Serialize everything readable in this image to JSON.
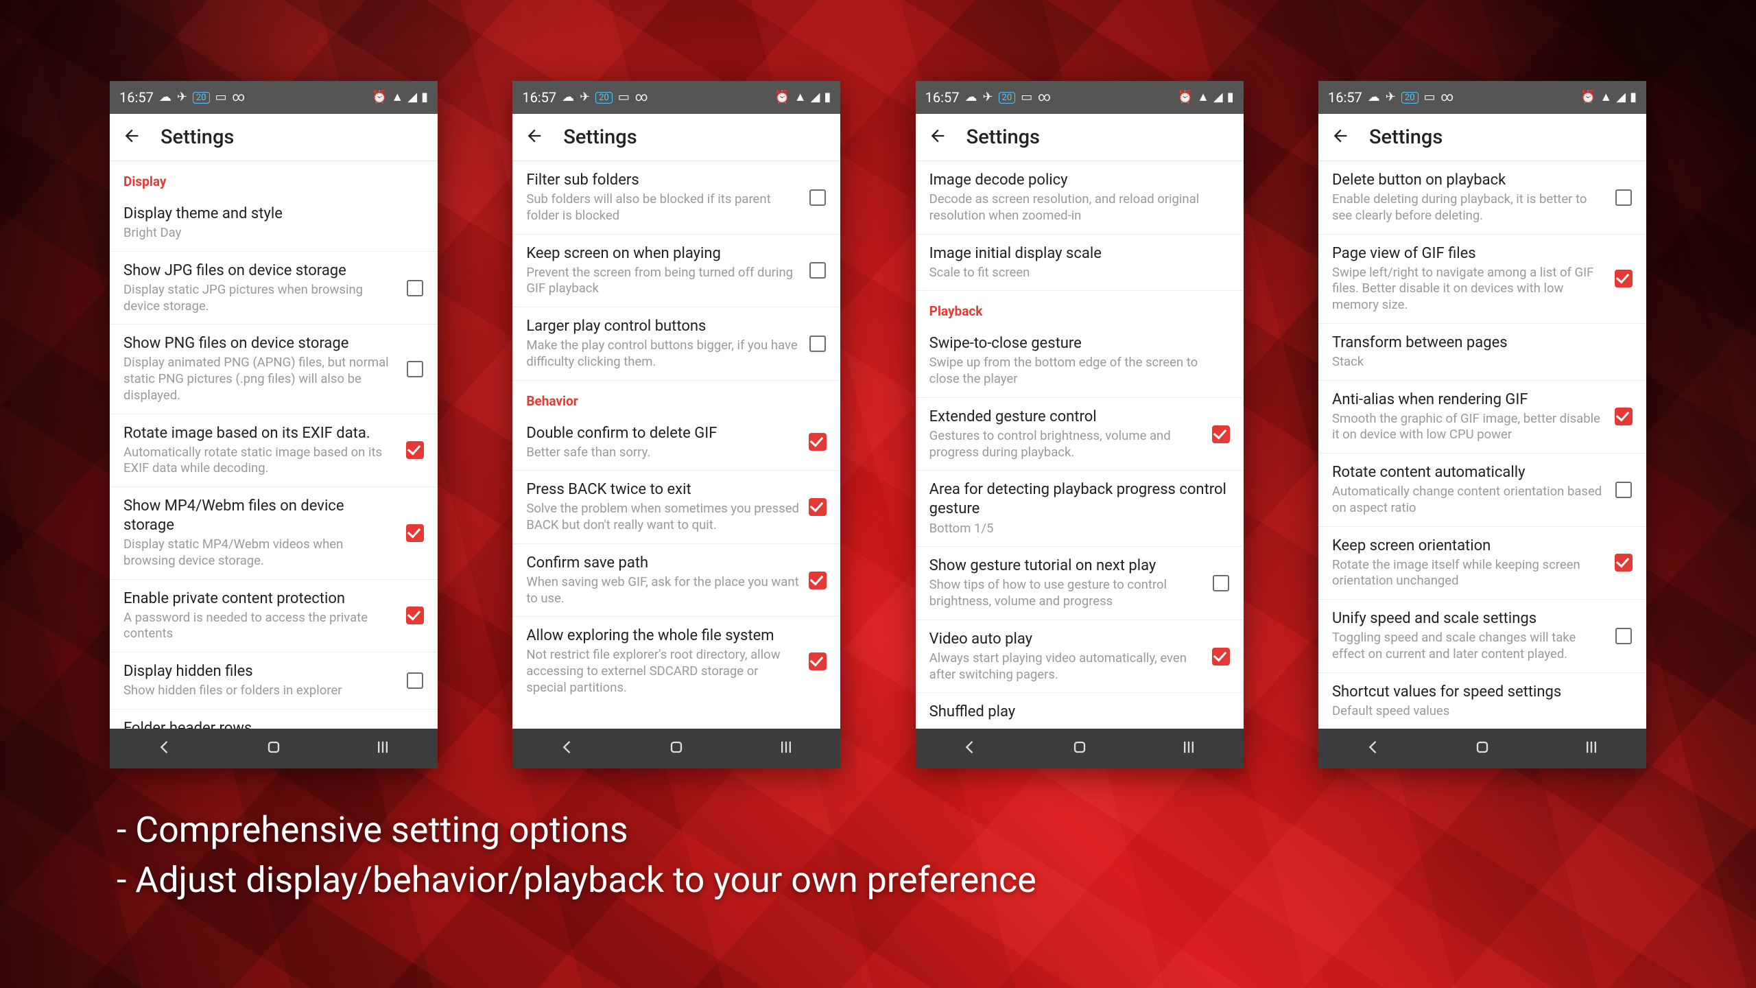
{
  "status_time": "16:57",
  "appbar_title": "Settings",
  "captions": [
    "- Comprehensive setting options",
    "- Adjust display/behavior/playback to your own preference"
  ],
  "phones": [
    {
      "groups": [
        {
          "header": "Display",
          "items": [
            {
              "title": "Display theme and style",
              "sub": "Bright Day",
              "checkbox": null
            },
            {
              "title": "Show JPG files on device storage",
              "sub": "Display static JPG pictures when browsing device storage.",
              "checkbox": false
            },
            {
              "title": "Show PNG files on device storage",
              "sub": "Display animated PNG (APNG) files, but normal static PNG pictures (.png files) will also be displayed.",
              "checkbox": false
            },
            {
              "title": "Rotate image based on its EXIF data.",
              "sub": "Automatically rotate static image based on its EXIF data while decoding.",
              "checkbox": true
            },
            {
              "title": "Show MP4/Webm files on device storage",
              "sub": "Display static MP4/Webm videos when browsing device storage.",
              "checkbox": true
            },
            {
              "title": "Enable private content protection",
              "sub": "A password is needed to access the private contents",
              "checkbox": true
            },
            {
              "title": "Display hidden files",
              "sub": "Show hidden files or folders in explorer",
              "checkbox": false
            },
            {
              "title": "Folder header rows",
              "sub": "",
              "checkbox": null
            }
          ]
        }
      ]
    },
    {
      "groups": [
        {
          "header": null,
          "items": [
            {
              "title": "Filter sub folders",
              "sub": "Sub folders will also be blocked if its parent folder is blocked",
              "checkbox": false
            },
            {
              "title": "Keep screen on when playing",
              "sub": "Prevent the screen from being turned off during GIF playback",
              "checkbox": false
            },
            {
              "title": "Larger play control buttons",
              "sub": "Make the play control buttons bigger, if you have difficulty clicking them.",
              "checkbox": false
            }
          ]
        },
        {
          "header": "Behavior",
          "items": [
            {
              "title": "Double confirm to delete GIF",
              "sub": "Better safe than sorry.",
              "checkbox": true
            },
            {
              "title": "Press BACK twice to exit",
              "sub": "Solve the problem when sometimes you pressed BACK but don't really want to quit.",
              "checkbox": true
            },
            {
              "title": "Confirm save path",
              "sub": "When saving web GIF, ask for the place you want to use.",
              "checkbox": true
            },
            {
              "title": "Allow exploring the whole file system",
              "sub": "Not restrict file explorer's root directory, allow accessing to externel SDCARD storage or special partitions.",
              "checkbox": true
            }
          ]
        }
      ]
    },
    {
      "groups": [
        {
          "header": null,
          "items": [
            {
              "title": "Image decode policy",
              "sub": "Decode as screen resolution, and reload original resolution when zoomed-in",
              "checkbox": null
            },
            {
              "title": "Image initial display scale",
              "sub": "Scale to fit screen",
              "checkbox": null
            }
          ]
        },
        {
          "header": "Playback",
          "items": [
            {
              "title": "Swipe-to-close gesture",
              "sub": "Swipe up from the bottom edge of the screen to close the player",
              "checkbox": null
            },
            {
              "title": "Extended gesture control",
              "sub": "Gestures to control brightness, volume and progress during playback.",
              "checkbox": true
            },
            {
              "title": "Area for detecting playback progress control gesture",
              "sub": "Bottom 1/5",
              "checkbox": null
            },
            {
              "title": "Show gesture tutorial on next play",
              "sub": "Show tips of how to use gesture to control brightness, volume and progress",
              "checkbox": false
            },
            {
              "title": "Video auto play",
              "sub": "Always start playing video automatically, even after switching pagers.",
              "checkbox": true
            },
            {
              "title": "Shuffled play",
              "sub": "",
              "checkbox": null
            }
          ]
        }
      ]
    },
    {
      "groups": [
        {
          "header": null,
          "items": [
            {
              "title": "Delete button on playback",
              "sub": "Enable deleting during playback, it is better to see clearly before deleting.",
              "checkbox": false
            },
            {
              "title": "Page view of GIF files",
              "sub": "Swipe left/right to navigate among a list of GIF files. Better disable it on devices with low memory size.",
              "checkbox": true
            },
            {
              "title": "Transform between pages",
              "sub": "Stack",
              "checkbox": null
            },
            {
              "title": "Anti-alias when rendering GIF",
              "sub": "Smooth the graphic of GIF image, better disable it on device with low CPU power",
              "checkbox": true
            },
            {
              "title": "Rotate content automatically",
              "sub": "Automatically change content orientation based on aspect ratio",
              "checkbox": false
            },
            {
              "title": "Keep screen orientation",
              "sub": "Rotate the image itself while keeping screen orientation unchanged",
              "checkbox": true
            },
            {
              "title": "Unify speed and scale settings",
              "sub": "Toggling speed and scale changes will take effect on current and later content played.",
              "checkbox": false
            },
            {
              "title": "Shortcut values for speed settings",
              "sub": "Default speed values",
              "checkbox": null
            }
          ]
        }
      ]
    }
  ]
}
